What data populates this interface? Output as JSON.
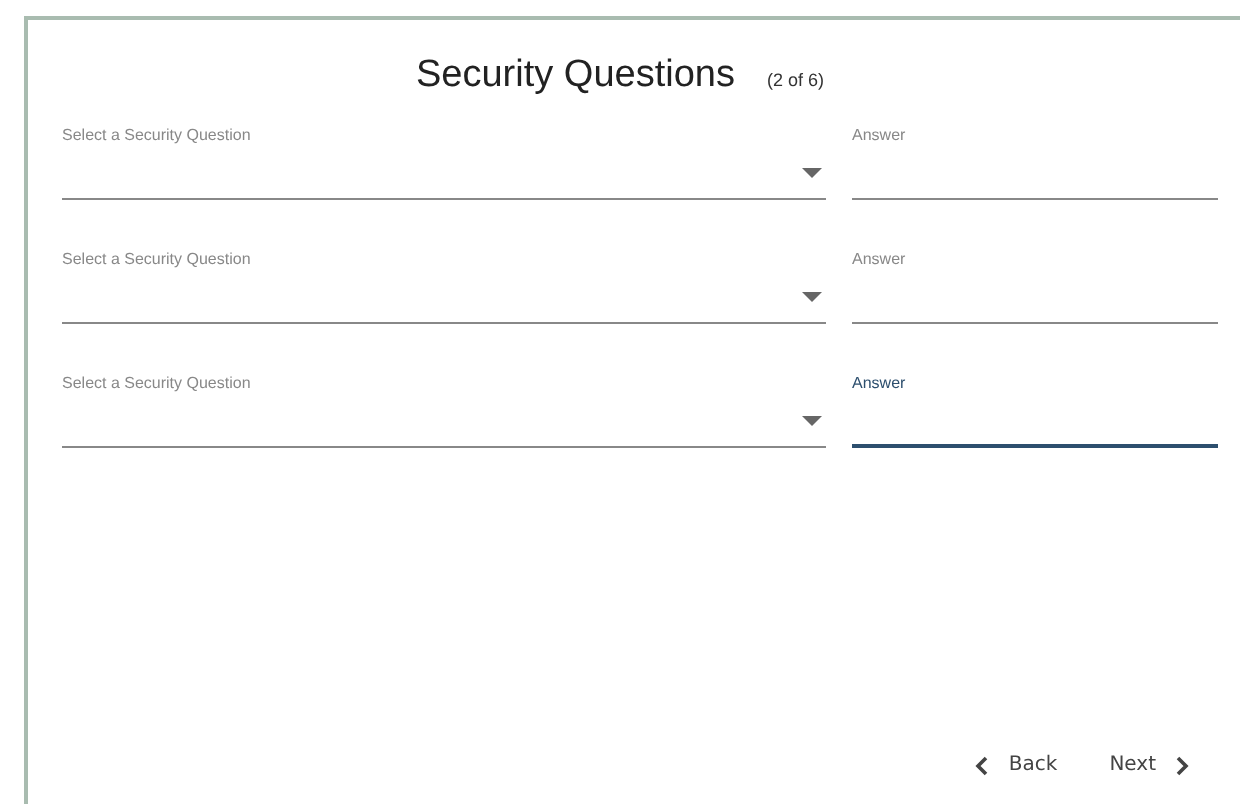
{
  "title": "Security Questions",
  "step": "(2 of 6)",
  "rows": [
    {
      "question_label": "Select a Security Question",
      "answer_label": "Answer",
      "focused": false
    },
    {
      "question_label": "Select a Security Question",
      "answer_label": "Answer",
      "focused": false
    },
    {
      "question_label": "Select a Security Question",
      "answer_label": "Answer",
      "focused": true
    }
  ],
  "buttons": {
    "back": "Back",
    "next": "Next"
  }
}
